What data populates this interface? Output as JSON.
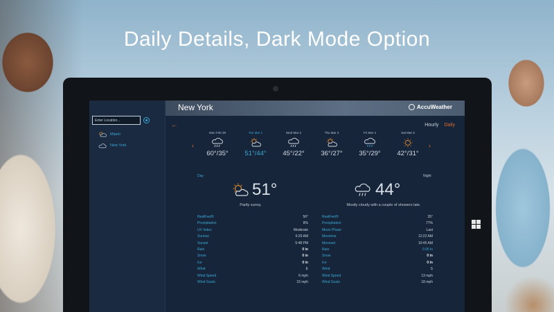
{
  "promo": {
    "headline": "Daily Details, Dark Mode Option"
  },
  "sidebar": {
    "search_placeholder": "Enter Location...",
    "locations": [
      {
        "name": "Miami",
        "icon": "partly-cloudy-icon"
      },
      {
        "name": "New York",
        "icon": "cloud-icon"
      }
    ]
  },
  "header": {
    "city": "New York",
    "brand": "AccuWeather"
  },
  "view_toggle": {
    "hourly": "Hourly",
    "daily": "Daily"
  },
  "forecast": {
    "days": [
      {
        "date": "Mon Feb 29",
        "icon": "rain-icon",
        "temps": "60°/35°",
        "selected": false
      },
      {
        "date": "Tue Mar 1",
        "icon": "partly-sunny-icon",
        "temps": "51°/44°",
        "selected": true
      },
      {
        "date": "Wed Mar 2",
        "icon": "rain-icon",
        "temps": "45°/22°",
        "selected": false
      },
      {
        "date": "Thu Mar 3",
        "icon": "partly-sunny-icon",
        "temps": "36°/27°",
        "selected": false
      },
      {
        "date": "Fri Mar 4",
        "icon": "snow-icon",
        "temps": "35°/29°",
        "selected": false
      },
      {
        "date": "Sat Mar 5",
        "icon": "sun-icon",
        "temps": "42°/31°",
        "selected": false
      }
    ]
  },
  "day": {
    "label": "Day",
    "temp": "51°",
    "phrase": "Partly sunny.",
    "details": [
      {
        "k": "RealFeel®",
        "v": "56°",
        "style": ""
      },
      {
        "k": "Precipitation",
        "v": "8%",
        "style": ""
      },
      {
        "k": "UV Index",
        "v": "Moderate",
        "style": ""
      },
      {
        "k": "Sunrise",
        "v": "6:29 AM",
        "style": ""
      },
      {
        "k": "Sunset",
        "v": "5:48 PM",
        "style": ""
      },
      {
        "k": "Rain",
        "v": "0 in",
        "style": "bold"
      },
      {
        "k": "Snow",
        "v": "0 in",
        "style": "bold"
      },
      {
        "k": "Ice",
        "v": "0 in",
        "style": "bold"
      },
      {
        "k": "Wind",
        "v": "E",
        "style": ""
      },
      {
        "k": "Wind Speed",
        "v": "6 mph",
        "style": ""
      },
      {
        "k": "Wind Gusts",
        "v": "15 mph",
        "style": ""
      }
    ]
  },
  "night": {
    "label": "Night",
    "temp": "44°",
    "phrase": "Mostly cloudy with a couple of showers late.",
    "details": [
      {
        "k": "RealFeel®",
        "v": "35°",
        "style": ""
      },
      {
        "k": "Precipitation",
        "v": "77%",
        "style": ""
      },
      {
        "k": "Moon Phase",
        "v": "Last",
        "style": ""
      },
      {
        "k": "Moonrise",
        "v": "12:22 AM",
        "style": ""
      },
      {
        "k": "Moonset",
        "v": "10:45 AM",
        "style": ""
      },
      {
        "k": "Rain",
        "v": "0.05 in",
        "style": "accent"
      },
      {
        "k": "Snow",
        "v": "0 in",
        "style": "bold"
      },
      {
        "k": "Ice",
        "v": "0 in",
        "style": "bold"
      },
      {
        "k": "Wind",
        "v": "S",
        "style": ""
      },
      {
        "k": "Wind Speed",
        "v": "13 mph",
        "style": ""
      },
      {
        "k": "Wind Gusts",
        "v": "18 mph",
        "style": ""
      }
    ]
  },
  "colors": {
    "accent": "#3aa9d6",
    "orange": "#e06a2c",
    "panel": "#17253a"
  }
}
